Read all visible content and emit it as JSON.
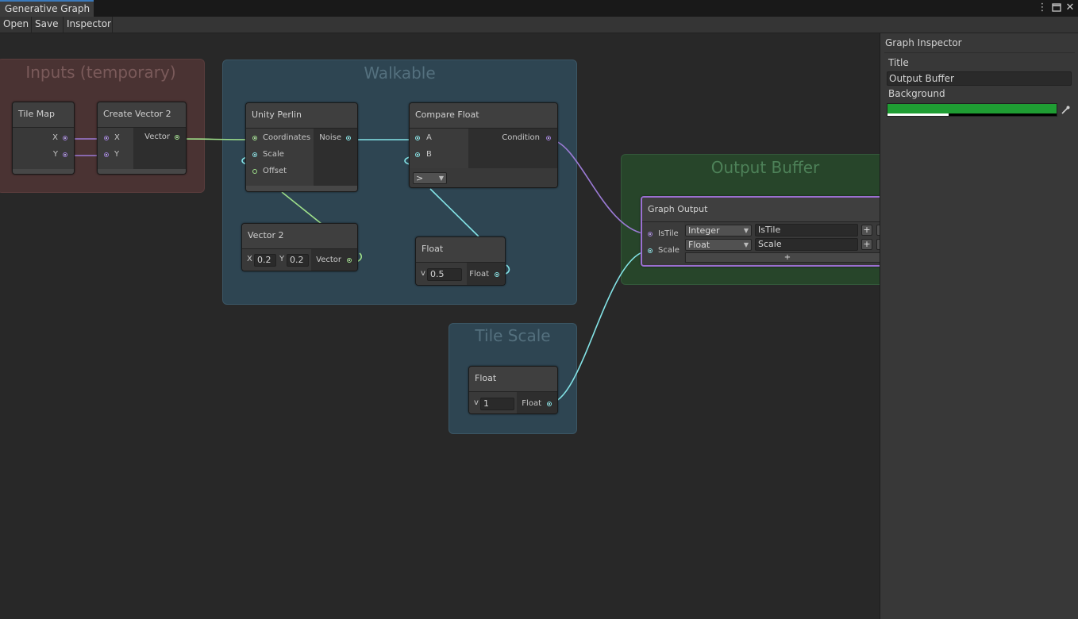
{
  "window": {
    "tab_title": "Generative Graph",
    "more_icon": "kebab-menu-icon",
    "maximize_icon": "maximize-icon",
    "close_icon": "close-icon"
  },
  "toolbar": {
    "open": "Open",
    "save": "Save",
    "inspector": "Inspector"
  },
  "groups": {
    "inputs": "Inputs (temporary)",
    "walkable": "Walkable",
    "output_buffer": "Output Buffer",
    "tile_scale": "Tile Scale"
  },
  "nodes": {
    "tile_map": {
      "title": "Tile Map",
      "out_x": "X",
      "out_y": "Y"
    },
    "create_vector2": {
      "title": "Create Vector 2",
      "in_x": "X",
      "in_y": "Y",
      "out": "Vector"
    },
    "unity_perlin": {
      "title": "Unity Perlin",
      "in_coordinates": "Coordinates",
      "in_scale": "Scale",
      "in_offset": "Offset",
      "out_noise": "Noise"
    },
    "compare_float": {
      "title": "Compare Float",
      "in_a": "A",
      "in_b": "B",
      "out_condition": "Condition",
      "operator": ">"
    },
    "vector2": {
      "title": "Vector 2",
      "x_label": "X",
      "x_value": "0.2",
      "y_label": "Y",
      "y_value": "0.2",
      "out": "Vector"
    },
    "float_walkable": {
      "title": "Float",
      "v_label": "v",
      "value": "0.5",
      "out": "Float"
    },
    "float_tile_scale": {
      "title": "Float",
      "v_label": "v",
      "value": "1",
      "out": "Float"
    },
    "graph_output": {
      "title": "Graph Output",
      "rows": [
        {
          "port": "IsTile",
          "type": "Integer",
          "name": "IsTile"
        },
        {
          "port": "Scale",
          "type": "Float",
          "name": "Scale"
        }
      ],
      "add_label": "+",
      "row_add_label": "+"
    }
  },
  "inspector": {
    "header": "Graph Inspector",
    "title_label": "Title",
    "title_value": "Output Buffer",
    "background_label": "Background",
    "background_color": "#1f9d33",
    "background_alpha": 0.36,
    "eyedropper_icon": "eyedropper-icon"
  },
  "colors": {
    "inputs_group": "#4a3333",
    "walkable_group": "#2e4552",
    "output_group": "#27452a",
    "tile_scale_group": "#2e4552",
    "wire_blue": "#84e4e7",
    "wire_purple": "#9c7bd6",
    "wire_green": "#9ee08a",
    "selected_border": "#9b6fd1"
  }
}
